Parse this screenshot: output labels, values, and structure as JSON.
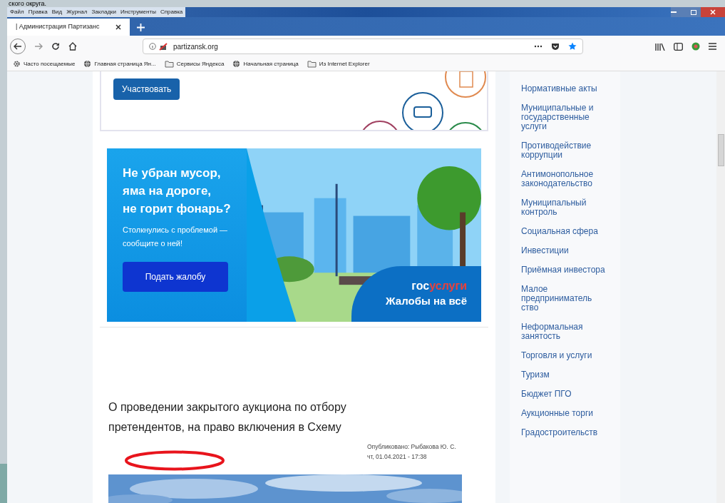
{
  "slide_caption": "ского округа.",
  "menu_bar": [
    "Файл",
    "Правка",
    "Вид",
    "Журнал",
    "Закладки",
    "Инструменты",
    "Справка"
  ],
  "tabs": [
    {
      "label": "| Администрация Партизанс",
      "selected": true
    }
  ],
  "address_bar": {
    "url": "partizansk.org"
  },
  "bookmarks": [
    {
      "kind": "gear",
      "label": "Часто посещаемые"
    },
    {
      "kind": "globe",
      "label": "Главная страница Ян..."
    },
    {
      "kind": "folder",
      "label": "Сервисы Яндекса"
    },
    {
      "kind": "globe",
      "label": "Начальная страница"
    },
    {
      "kind": "folder",
      "label": "Из Internet Explorer"
    }
  ],
  "promo_card": {
    "button": "Участвовать"
  },
  "banner": {
    "headline": [
      "Не убран мусор,",
      "яма на дороге,",
      "не горит фонарь?"
    ],
    "text": "Столкнулись с проблемой — сообщите о ней!",
    "button": "Подать жалобу",
    "brand_left": "гос",
    "brand_right": "услуги",
    "slogan": "Жалобы на всё"
  },
  "article": {
    "title": "О проведении закрытого аукциона по отбору претендентов, на право включения в Схему",
    "author": "Опубликовано: Рыбакова Ю. С.",
    "date": "чт, 01.04.2021 - 17:38"
  },
  "sidebar": {
    "items": [
      "Нормативные акты",
      "Муниципальные и государственные услуги",
      "Противодействие коррупции",
      "Антимонопольное законодательство",
      "Муниципальный контроль",
      "Социальная сфера",
      "Инвестиции",
      "Приёмная инвестора",
      "Малое предприниматель ство",
      "Неформальная занятость",
      "Торговля и услуги",
      "Туризм",
      "Бюджет ПГО",
      "Аукционные торги",
      "Градостроительств"
    ]
  }
}
